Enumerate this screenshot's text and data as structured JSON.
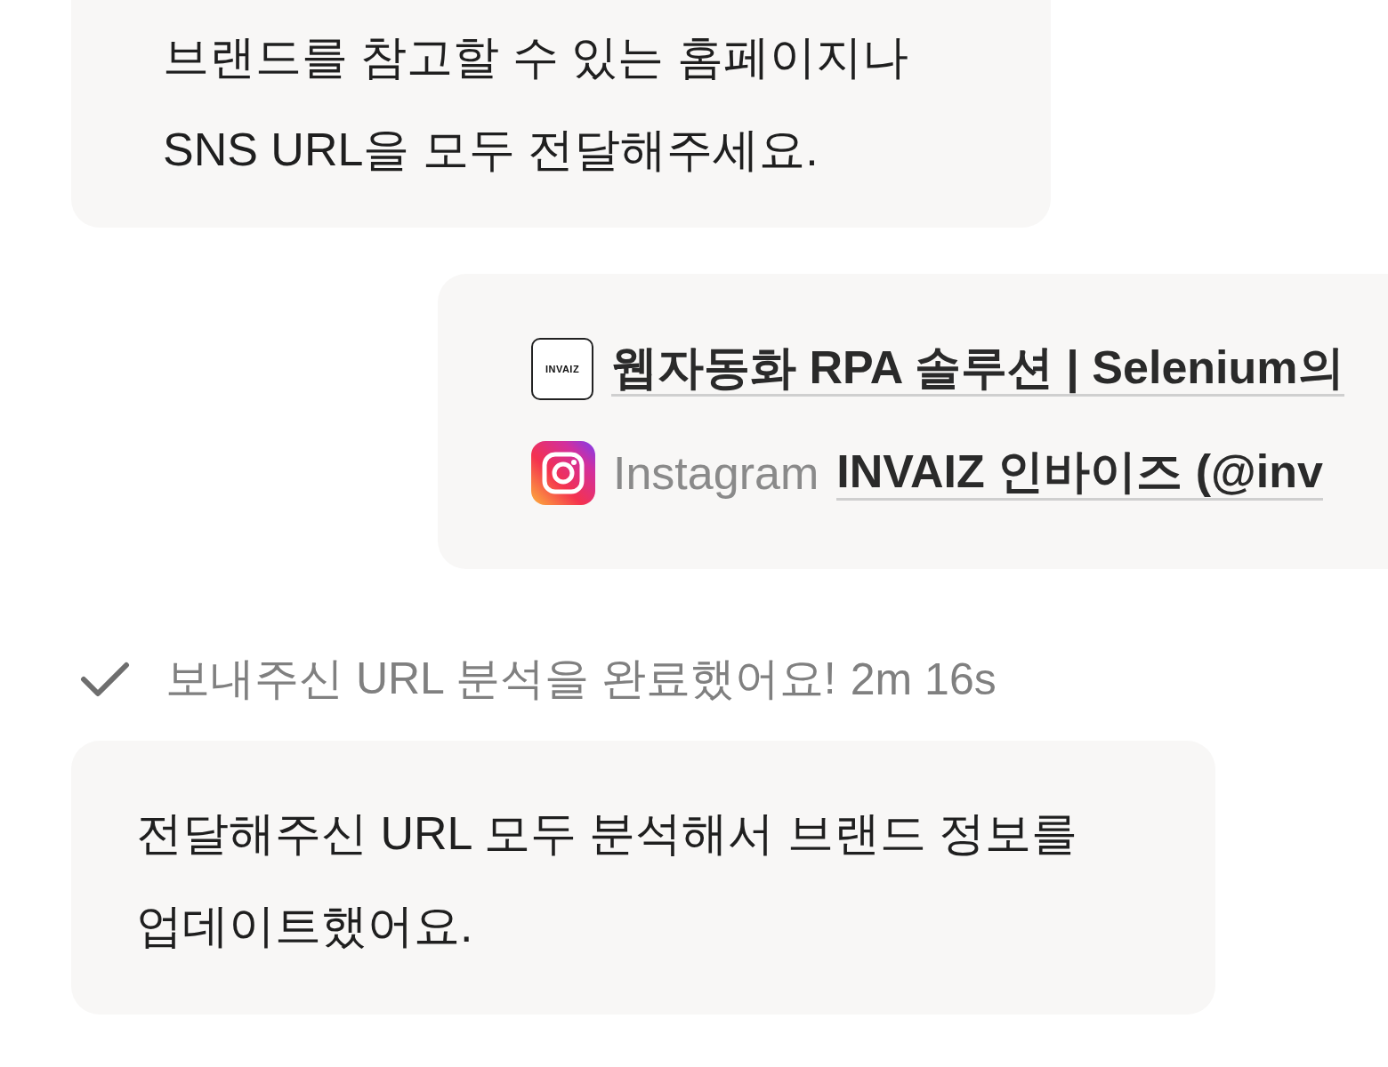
{
  "messages": [
    {
      "kind": "bubble",
      "lines": [
        "브랜드를 참고할 수 있는 홈페이지나",
        "SNS URL을 모두 전달해주세요."
      ]
    },
    {
      "kind": "links",
      "items": [
        {
          "kind": "site",
          "logo_text": "INVAIZ",
          "title": "웹자동화 RPA 솔루션 | Selenium의"
        },
        {
          "kind": "social",
          "source": "Instagram",
          "title": "INVAIZ 인바이즈 (@inv"
        }
      ]
    },
    {
      "kind": "status",
      "done": true,
      "text": "보내주신 URL 분석을 완료했어요!",
      "time": "2m 16s"
    },
    {
      "kind": "bubble",
      "lines": [
        "전달해주신 URL 모두 분석해서 브랜드 정보를",
        "업데이트했어요."
      ]
    }
  ]
}
